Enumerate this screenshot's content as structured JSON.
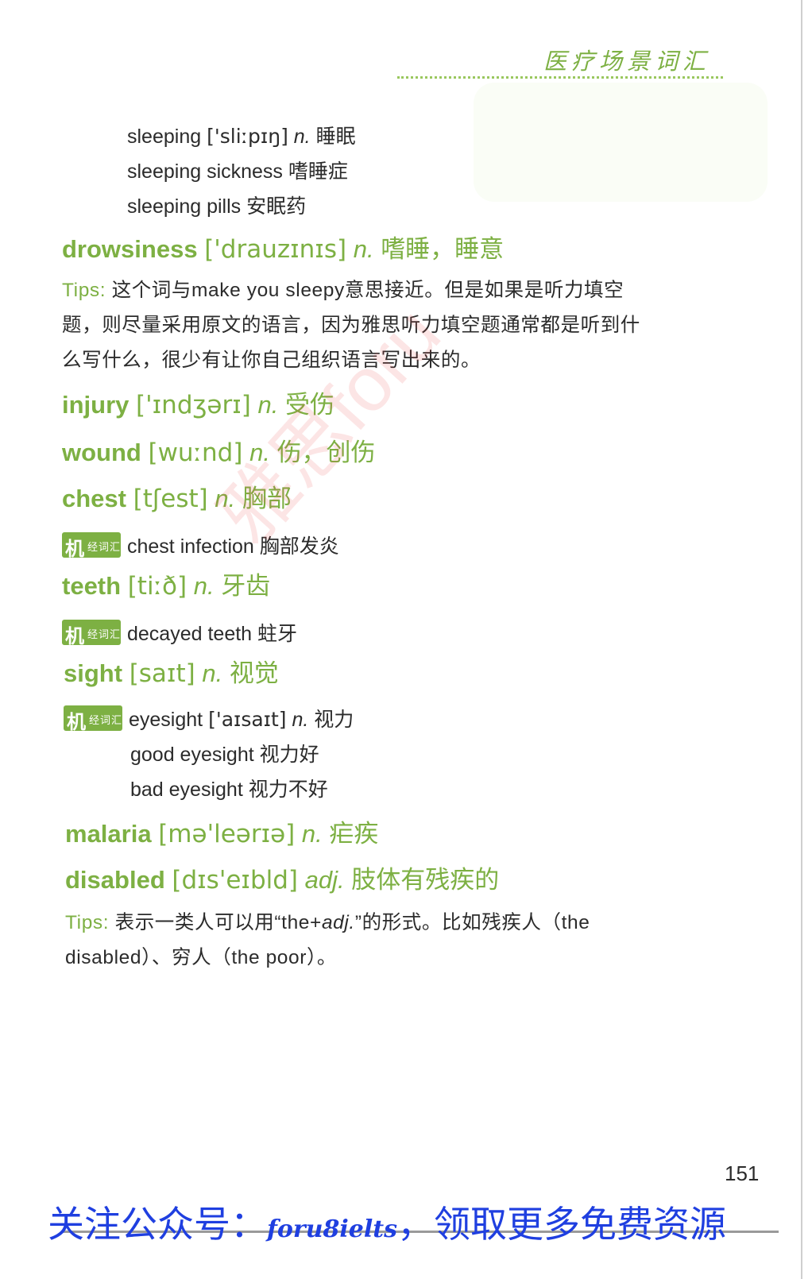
{
  "header": {
    "title": "医疗场景词汇"
  },
  "entries": {
    "sleeping": {
      "word": "sleeping",
      "pron": "['sliːpɪŋ]",
      "pos": "n.",
      "meaning": "睡眠"
    },
    "sleeping_sickness": {
      "text": "sleeping sickness",
      "meaning": "嗜睡症"
    },
    "sleeping_pills": {
      "text": "sleeping pills",
      "meaning": "安眠药"
    },
    "drowsiness": {
      "word": "drowsiness",
      "pron": "['drauzɪnɪs]",
      "pos": "n.",
      "meaning": "嗜睡，睡意"
    },
    "tips1": {
      "label": "Tips:",
      "line1": "这个词与make you sleepy意思接近。但是如果是听力填空",
      "line2": "题，则尽量采用原文的语言，因为雅思听力填空题通常都是听到什",
      "line3": "么写什么，很少有让你自己组织语言写出来的。"
    },
    "injury": {
      "word": "injury",
      "pron": "['ɪndʒərɪ]",
      "pos": "n.",
      "meaning": "受伤"
    },
    "wound": {
      "word": "wound",
      "pron": "[wuːnd]",
      "pos": "n.",
      "meaning": "伤，创伤"
    },
    "chest": {
      "word": "chest",
      "pron": "[tʃest]",
      "pos": "n.",
      "meaning": "胸部"
    },
    "chest_infection": {
      "text": "chest infection",
      "meaning": "胸部发炎"
    },
    "teeth": {
      "word": "teeth",
      "pron": "[tiːð]",
      "pos": "n.",
      "meaning": "牙齿"
    },
    "decayed_teeth": {
      "text": "decayed teeth",
      "meaning": "蛀牙"
    },
    "sight": {
      "word": "sight",
      "pron": "[saɪt]",
      "pos": "n.",
      "meaning": "视觉"
    },
    "eyesight": {
      "word": "eyesight",
      "pron": "['aɪsaɪt]",
      "pos": "n.",
      "meaning": "视力"
    },
    "good_eyesight": {
      "text": "good eyesight",
      "meaning": "视力好"
    },
    "bad_eyesight": {
      "text": "bad eyesight",
      "meaning": "视力不好"
    },
    "malaria": {
      "word": "malaria",
      "pron": "[mə'leərɪə]",
      "pos": "n.",
      "meaning": "疟疾"
    },
    "disabled": {
      "word": "disabled",
      "pron": "[dɪs'eɪbld]",
      "pos": "adj.",
      "meaning": "肢体有残疾的"
    },
    "tips2": {
      "label": "Tips:",
      "line1_a": "表示一类人可以用“the+",
      "line1_b": "adj.",
      "line1_c": "”的形式。比如残疾人（the",
      "line2": "disabled）、穷人（the poor）。"
    }
  },
  "badge": {
    "char": "机",
    "small": "经词汇"
  },
  "watermark": "雅思foru",
  "page_number": "151",
  "footer": {
    "prefix": "关注公众号：",
    "account": "foru8ielts",
    "suffix": "，领取更多免费资源"
  },
  "colors": {
    "accent": "#7db043",
    "footer_text": "#1f3fe0",
    "watermark": "#eb4646"
  }
}
